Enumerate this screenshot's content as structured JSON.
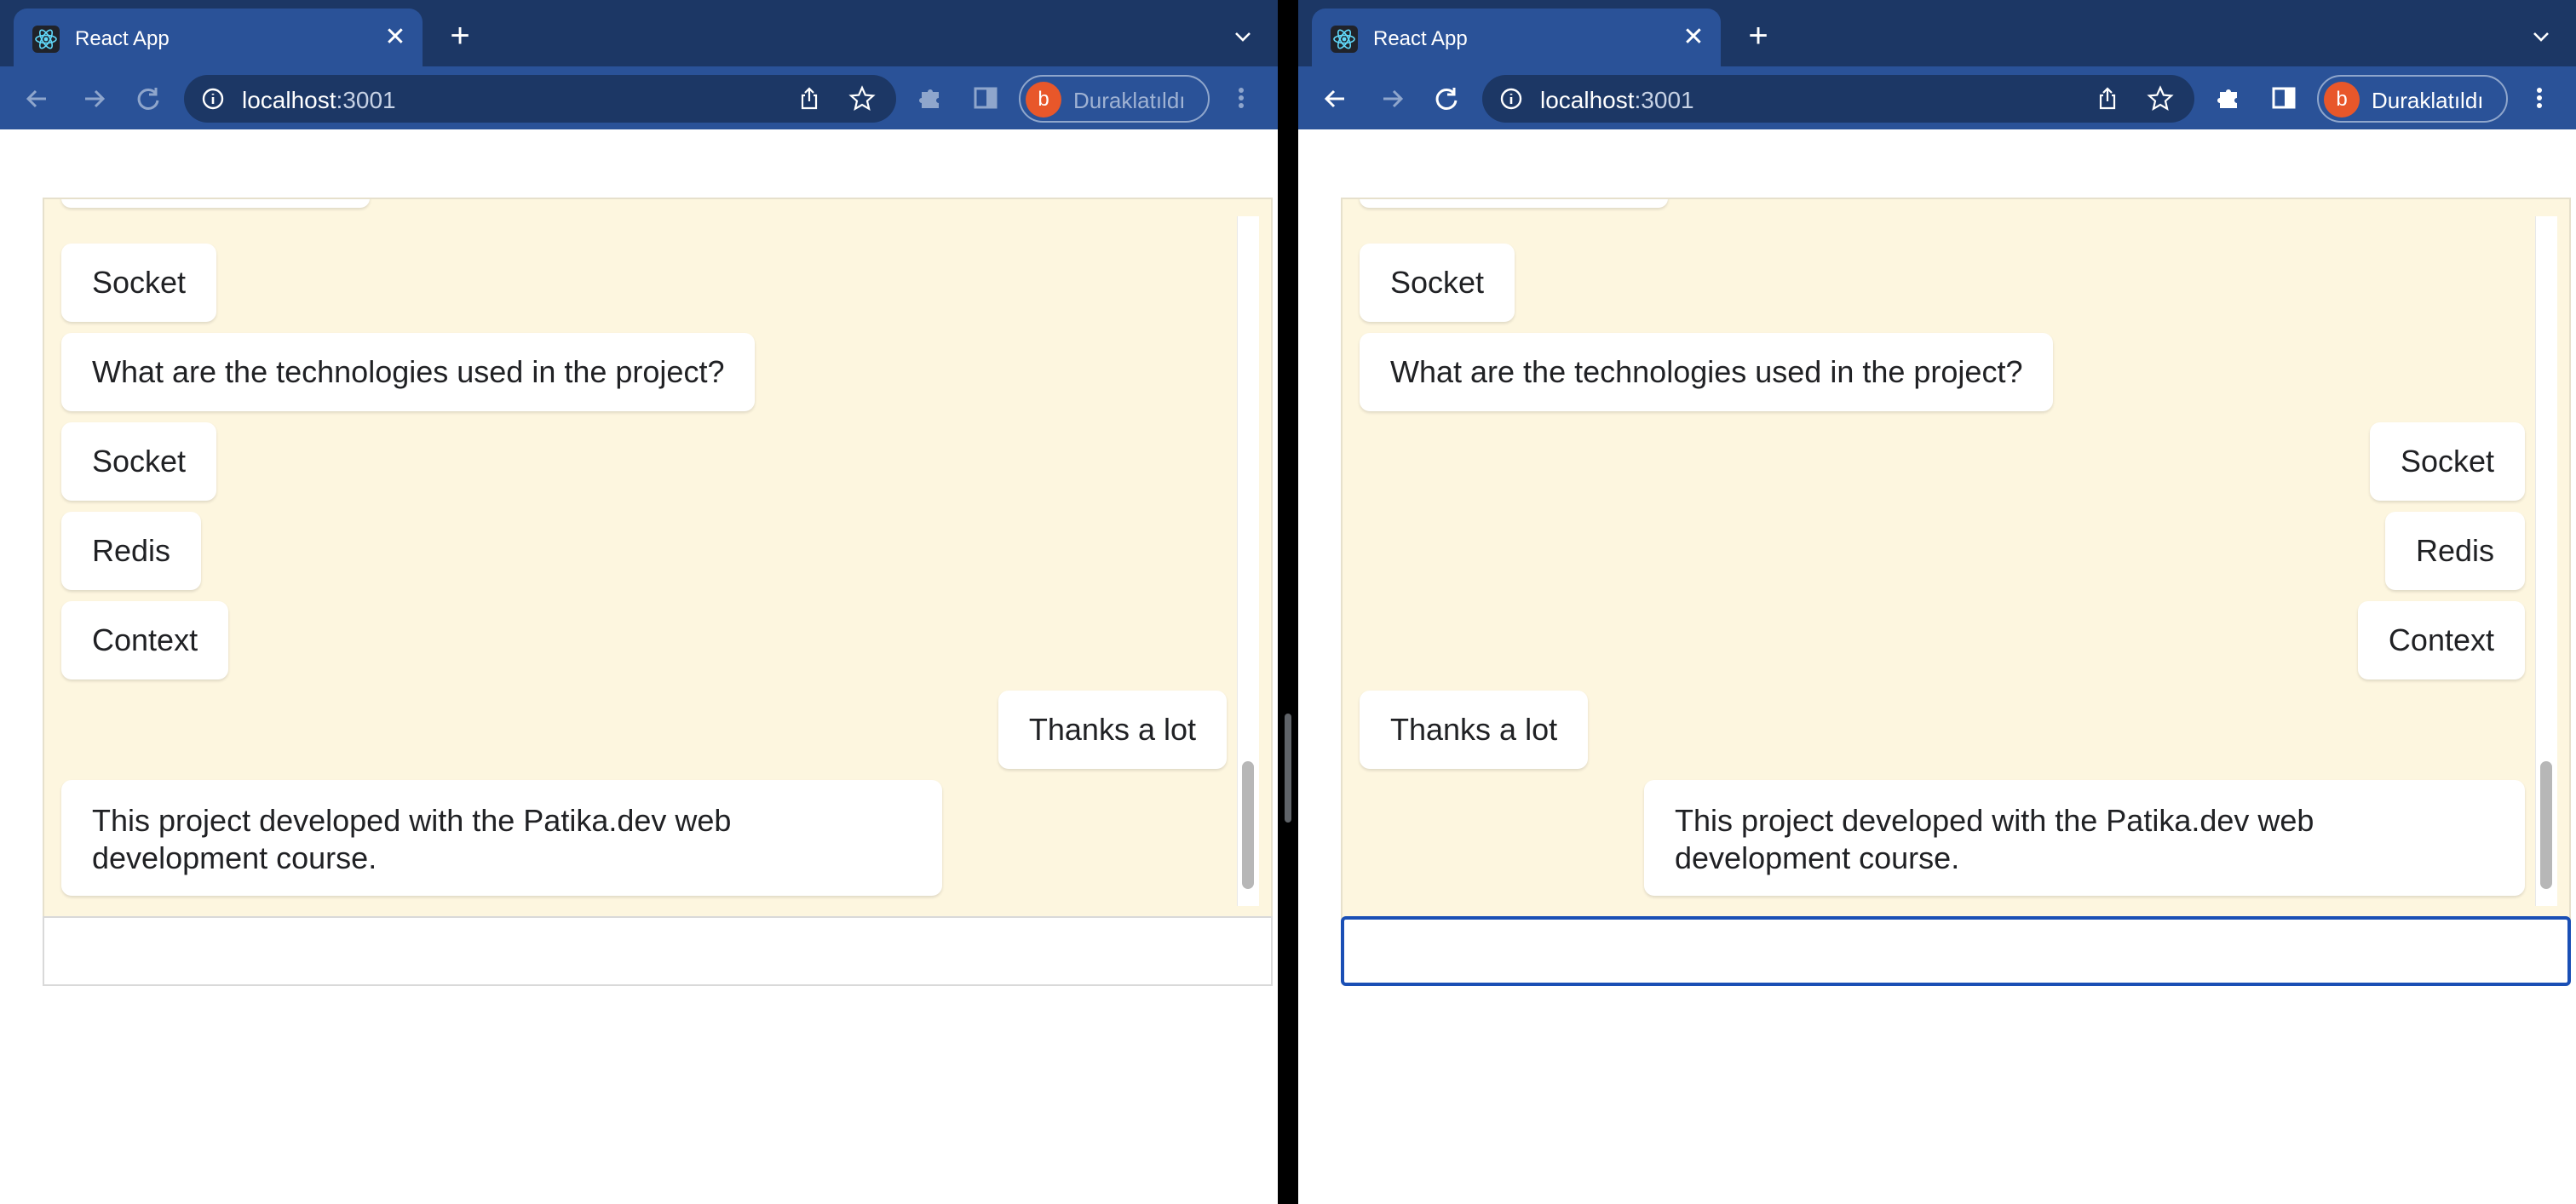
{
  "windows": [
    {
      "tab_title": "React App",
      "url_host": "localhost",
      "url_port": ":3001",
      "profile_initial": "b",
      "profile_label": "Duraklatıldı",
      "messages": [
        {
          "text": "Socket",
          "align": "left"
        },
        {
          "text": "What are the technologies used in the project?",
          "align": "left"
        },
        {
          "text": "Socket",
          "align": "left"
        },
        {
          "text": "Redis",
          "align": "left"
        },
        {
          "text": "Context",
          "align": "left"
        },
        {
          "text": "Thanks a lot",
          "align": "right"
        },
        {
          "text": "This project developed with the Patika.dev web development course.",
          "align": "left"
        }
      ],
      "input_value": ""
    },
    {
      "tab_title": "React App",
      "url_host": "localhost",
      "url_port": ":3001",
      "profile_initial": "b",
      "profile_label": "Duraklatıldı",
      "messages": [
        {
          "text": "Socket",
          "align": "left"
        },
        {
          "text": "What are the technologies used in the project?",
          "align": "left"
        },
        {
          "text": "Socket",
          "align": "right"
        },
        {
          "text": "Redis",
          "align": "right"
        },
        {
          "text": "Context",
          "align": "right"
        },
        {
          "text": "Thanks a lot",
          "align": "left"
        },
        {
          "text": "This project developed with the Patika.dev web development course.",
          "align": "right"
        }
      ],
      "input_value": ""
    }
  ],
  "colors": {
    "tab_strip": "#1c3765",
    "toolbar": "#2a5298",
    "chat_background": "#fdf6df",
    "message_bubble": "#ffffff",
    "focus_ring": "#1a4fb5",
    "avatar": "#e8572a"
  },
  "icons": [
    "react-logo-icon",
    "close-icon",
    "plus-icon",
    "chevron-down-icon",
    "back-arrow-icon",
    "forward-arrow-icon",
    "reload-icon",
    "info-icon",
    "share-icon",
    "star-icon",
    "puzzle-icon",
    "side-panel-icon",
    "menu-dots-icon"
  ]
}
